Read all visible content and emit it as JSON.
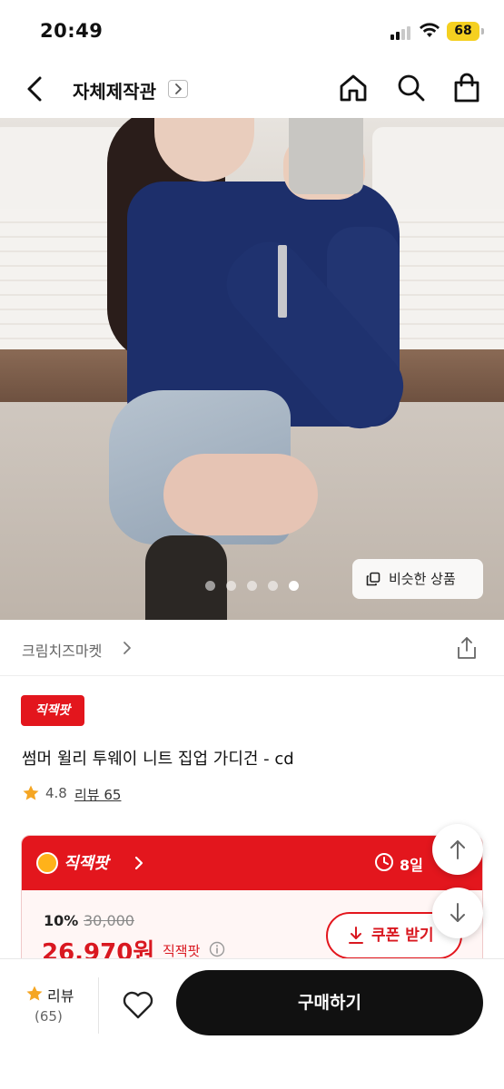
{
  "status_bar": {
    "time": "20:49",
    "battery": "68"
  },
  "nav": {
    "title": "자체제작관",
    "icons": [
      "back-arrow-icon",
      "chevron-right-icon",
      "home-icon",
      "search-icon",
      "bag-icon"
    ]
  },
  "hero": {
    "similar_label": "비슷한 상품",
    "carousel": {
      "total": 5,
      "active_index": 4
    }
  },
  "seller": {
    "name": "크림치즈마켓"
  },
  "product": {
    "badge": "직잭팟",
    "title": "썸머 윌리 투웨이 니트 집업 가디건 - cd",
    "rating": "4.8",
    "review_link": "리뷰 65"
  },
  "promo": {
    "brand": "직잭팟",
    "time_left": "8일 ",
    "discount": "10%",
    "original_price": "30,000",
    "sale_price": "26,970원",
    "price_brand": "직잭팟",
    "coupon_label": "쿠폰 받기"
  },
  "bottom": {
    "review_label": "리뷰",
    "review_count": "(65)",
    "buy_label": "구매하기"
  },
  "colors": {
    "accent_red": "#e3161d",
    "price_red": "#d91820",
    "battery_yellow": "#f5d020"
  }
}
